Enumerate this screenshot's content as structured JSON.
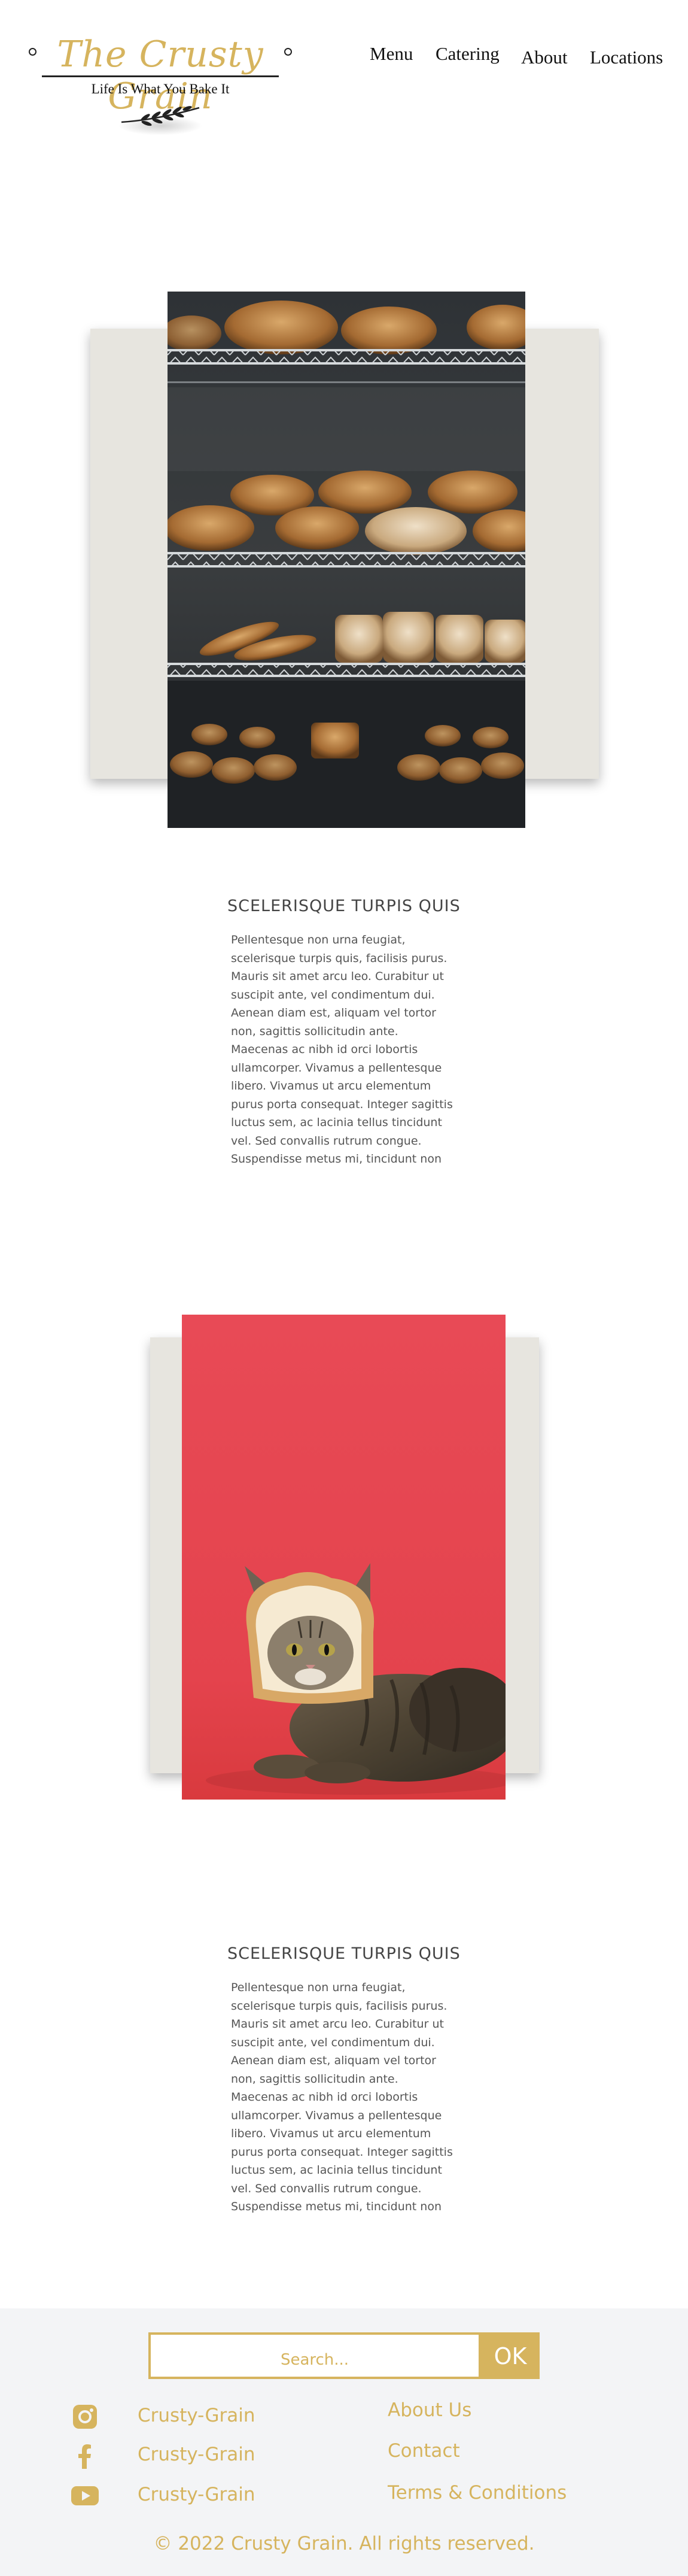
{
  "header": {
    "logo_title": "The Crusty Grain",
    "tagline": "Life Is What You Bake It",
    "nav": [
      "Menu",
      "Catering",
      "About",
      "Locations"
    ]
  },
  "sections": [
    {
      "image": "bakery-bread-shelves",
      "title": "SCELERISQUE TURPIS QUIS",
      "body": "Pellentesque non urna feugiat, scelerisque turpis quis, facilisis purus. Mauris sit amet arcu leo. Curabitur ut suscipit ante, vel condimentum dui. Aenean diam est, aliquam vel tortor non, sagittis sollicitudin ante. Maecenas ac nibh id orci lobortis ullamcorper. Vivamus a pellentesque libero. Vivamus ut arcu elementum purus porta consequat. Integer sagittis luctus sem, ac lacinia tellus tincidunt vel. Sed convallis rutrum congue. Suspendisse metus mi, tincidunt non"
    },
    {
      "image": "cat-in-bread-slice",
      "title": "SCELERISQUE TURPIS QUIS",
      "body": "Pellentesque non urna feugiat, scelerisque turpis quis, facilisis purus. Mauris sit amet arcu leo. Curabitur ut suscipit ante, vel condimentum dui. Aenean diam est, aliquam vel tortor non, sagittis sollicitudin ante. Maecenas ac nibh id orci lobortis ullamcorper. Vivamus a pellentesque libero. Vivamus ut arcu elementum purus porta consequat. Integer sagittis luctus sem, ac lacinia tellus tincidunt vel. Sed convallis rutrum congue. Suspendisse metus mi, tincidunt non"
    }
  ],
  "footer": {
    "search_placeholder": "Search...",
    "search_button": "OK",
    "social": [
      {
        "icon": "instagram-icon",
        "label": "Crusty-Grain"
      },
      {
        "icon": "facebook-icon",
        "label": "Crusty-Grain"
      },
      {
        "icon": "youtube-icon",
        "label": "Crusty-Grain"
      }
    ],
    "links": [
      "About Us",
      "Contact",
      "Terms & Conditions"
    ],
    "copyright": "© 2022 Crusty Grain. All rights reserved."
  },
  "colors": {
    "accent_gold": "#d6b45e",
    "card_bg": "#e7e5df",
    "footer_bg": "#f3f4f6",
    "cat_photo_red": "#e34a52"
  }
}
